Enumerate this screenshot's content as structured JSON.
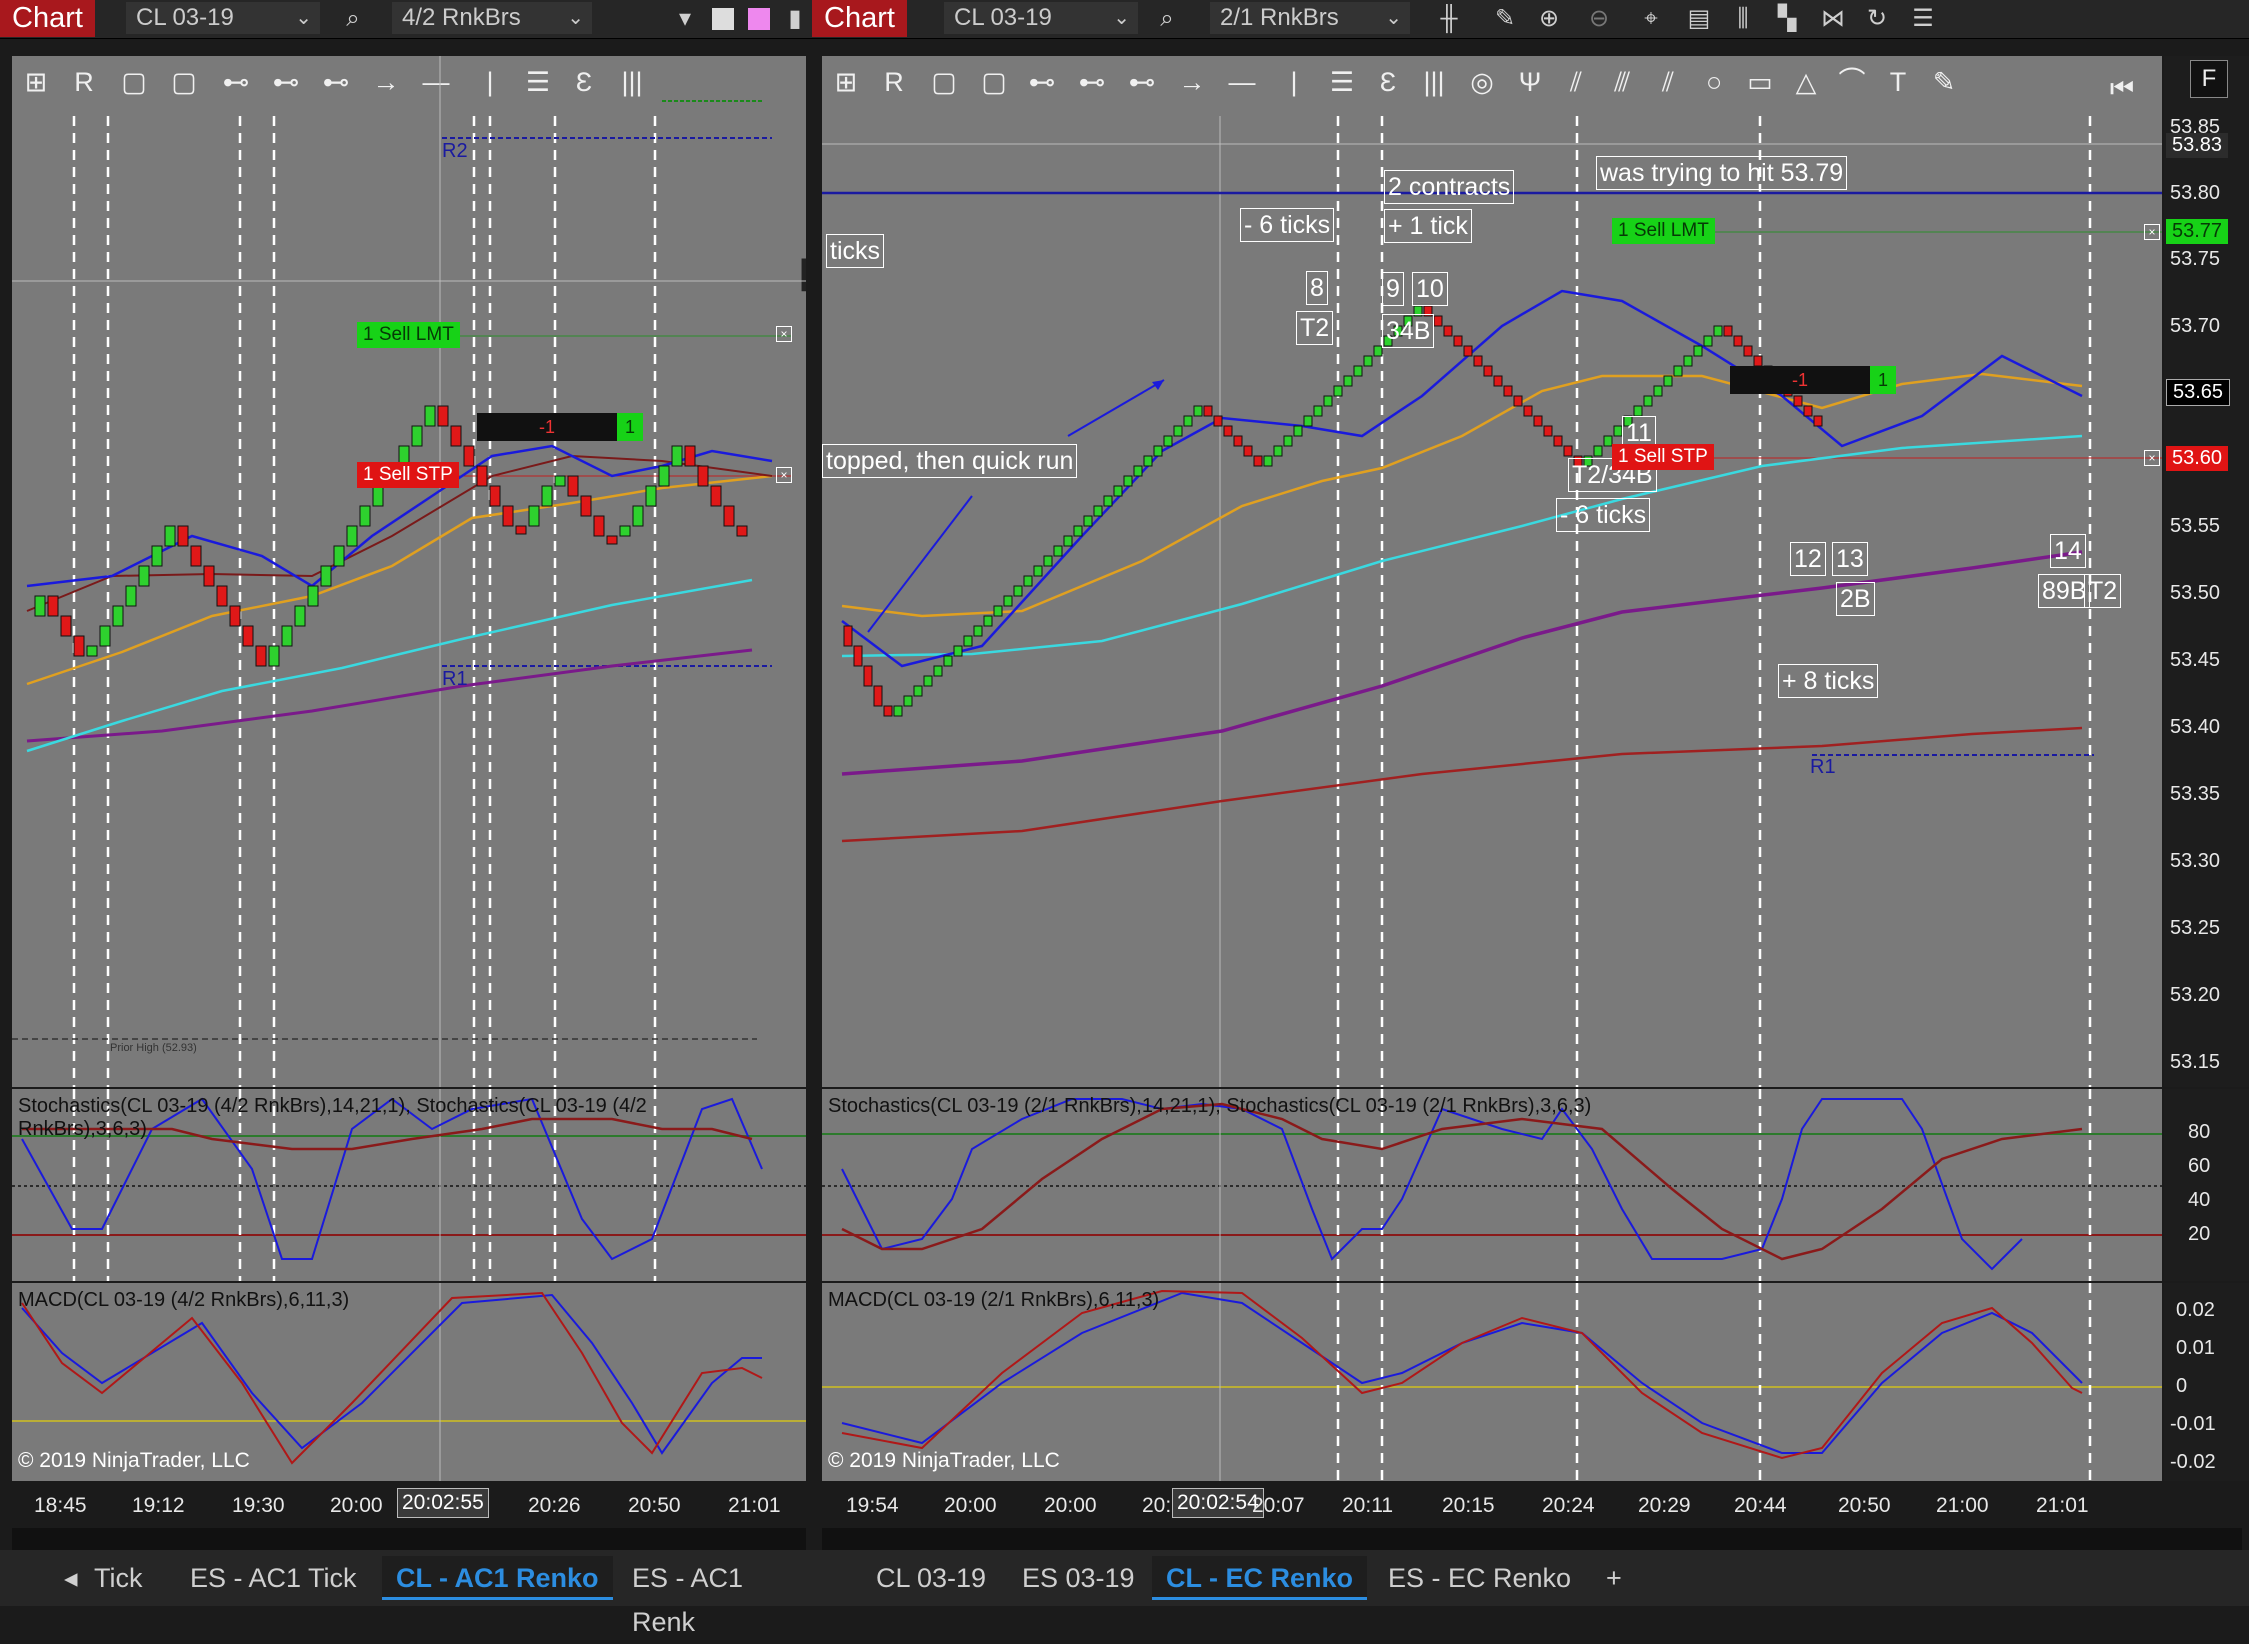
{
  "left": {
    "chart_tab": "Chart",
    "instrument": "CL 03-19",
    "bars": "4/2 RnkBrs",
    "r2": "R2",
    "r1": "R1",
    "prior_high": "Prior High (52.93)",
    "sell_lmt": "1 Sell LMT",
    "sell_stp": "1 Sell STP",
    "position": "-1",
    "position_qty": "1",
    "stoch_title": "Stochastics(CL 03-19 (4/2 RnkBrs),14,21,1), Stochastics(CL 03-19 (4/2\nRnkBrs),3,6,3)",
    "macd_title": "MACD(CL 03-19 (4/2 RnkBrs),6,11,3)",
    "copyright": "© 2019 NinjaTrader, LLC",
    "time_labels": [
      "18:45",
      "19:12",
      "19:30",
      "20:00",
      "20:26",
      "20:50",
      "21:01"
    ],
    "cursor_time": "20:02:55",
    "tabs": [
      "Tick",
      "ES - AC1 Tick",
      "CL - AC1 Renko",
      "ES - AC1 Renk"
    ],
    "active_tab": "CL - AC1 Renko"
  },
  "right": {
    "chart_tab": "Chart",
    "instrument": "CL 03-19",
    "bars": "2/1 RnkBrs",
    "r1": "R1",
    "sell_lmt": "1 Sell LMT",
    "sell_stp": "1 Sell STP",
    "position": "-1",
    "position_qty": "1",
    "notes": {
      "ticks": "ticks",
      "stopped": "topped, then quick run",
      "minus6a": "- 6 ticks",
      "contracts": "2 contracts",
      "plus1": "+ 1 tick",
      "trying": "was trying to hit 53.79",
      "n8": "8",
      "t2a": "T2",
      "n9": "9",
      "n10": "10",
      "n34b": "34B",
      "n11": "11",
      "t234b": "T2/34B",
      "minus6b": "- 6 ticks",
      "n12": "12",
      "n13": "13",
      "n2b": "2B",
      "n14": "14",
      "n89b": "89B",
      "t2b": "T2",
      "plus8": "+ 8 ticks"
    },
    "price_labels": [
      "53.85",
      "53.83",
      "53.80",
      "53.77",
      "53.75",
      "53.70",
      "53.65",
      "53.60",
      "53.55",
      "53.50",
      "53.45",
      "53.40",
      "53.35",
      "53.30",
      "53.25",
      "53.20",
      "53.15"
    ],
    "price_current": "53.65",
    "price_lmt": "53.77",
    "price_stp": "53.60",
    "price_r2": "53.83",
    "stoch_title": "Stochastics(CL 03-19 (2/1 RnkBrs),14,21,1), Stochastics(CL 03-19 (2/1 RnkBrs),3,6,3)",
    "stoch_axis": [
      "80",
      "60",
      "40",
      "20"
    ],
    "macd_title": "MACD(CL 03-19 (2/1 RnkBrs),6,11,3)",
    "macd_axis": [
      "0.02",
      "0.01",
      "0",
      "-0.01",
      "-0.02"
    ],
    "copyright": "© 2019 NinjaTrader, LLC",
    "time_labels": [
      "19:54",
      "20:00",
      "20:00",
      "20:",
      "20:07",
      "20:11",
      "20:15",
      "20:24",
      "20:29",
      "20:44",
      "20:50",
      "21:00",
      "21:01"
    ],
    "cursor_time": "20:02:54",
    "tabs": [
      "CL 03-19",
      "ES 03-19",
      "CL - EC Renko",
      "ES - EC Renko",
      "+"
    ],
    "active_tab": "CL - EC Renko",
    "f_button": "F"
  },
  "colors": {
    "panel_bg": "#7a7a7a",
    "up_bar": "#2ed12e",
    "down_bar": "#e01818",
    "chart_tab": "#a8181d",
    "active_tab": "#2c8de0"
  }
}
